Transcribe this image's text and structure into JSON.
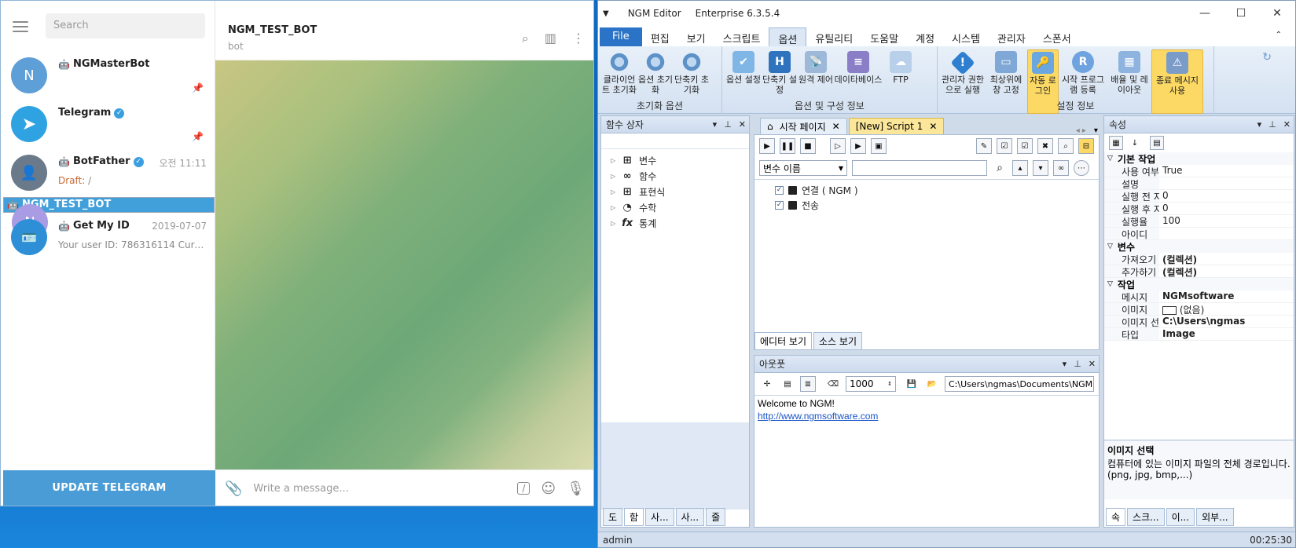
{
  "telegram": {
    "search_placeholder": "Search",
    "chats": [
      {
        "name": "NGMasterBot",
        "avatar_letter": "N",
        "avatar_color": "#5e9fd8",
        "pinned": true,
        "bot": true
      },
      {
        "name": "Telegram",
        "avatar_color": "#2fa3e2",
        "verified": true,
        "pinned": true
      },
      {
        "name": "BotFather",
        "verified": true,
        "bot": true,
        "time": "오전 11:11",
        "draft_label": "Draft:",
        "draft_text": "/"
      },
      {
        "name": "NGM_TEST_BOT",
        "avatar_letter": "N",
        "avatar_color": "#a99be4",
        "bot": true,
        "selected": true
      },
      {
        "name": "Get My ID",
        "bot": true,
        "time": "2019-07-07",
        "message": "Your user ID: 786316114 Curre..."
      }
    ],
    "update_button": "UPDATE TELEGRAM",
    "chat_title": "NGM_TEST_BOT",
    "chat_subtitle": "bot",
    "message_placeholder": "Write a message...",
    "selected_color": "#419fd9"
  },
  "ngm": {
    "app_name": "NGM Editor",
    "edition": "Enterprise 6.3.5.4",
    "menu": [
      "File",
      "편집",
      "보기",
      "스크립트",
      "옵션",
      "유틸리티",
      "도움말",
      "계정",
      "시스템",
      "관리자",
      "스폰서"
    ],
    "active_menu": "옵션",
    "ribbon": {
      "group1": {
        "label": "초기화 옵션",
        "buttons": [
          "클라이언트 초기화",
          "옵션 초기화",
          "단축키 초기화"
        ]
      },
      "group2": {
        "label": "옵션 및 구성 정보",
        "buttons": [
          "옵션 설정",
          "단축키 설정",
          "원격 제어",
          "데이타베이스",
          "FTP"
        ]
      },
      "group3": {
        "label": "설정 정보",
        "buttons": [
          "관리자 권한으로 실행",
          "최상위에 창 고정",
          "자동 로그인",
          "시작 프로그램 등록",
          "배율 및 레이아웃",
          "종료 메시지 사용"
        ]
      }
    },
    "function_panel": {
      "title": "함수 상자",
      "items": [
        "변수",
        "함수",
        "표현식",
        "수학",
        "통계"
      ]
    },
    "doc_tabs": [
      "시작 페이지",
      "[New] Script 1"
    ],
    "script": {
      "var_select": "변수 이름",
      "items": [
        "연결 ( NGM )",
        "전송"
      ],
      "view_tabs": [
        "에디터 보기",
        "소스 보기"
      ]
    },
    "output": {
      "title": "아웃풋",
      "count": "1000",
      "path": "C:\\Users\\ngmas\\Documents\\NGM6\\",
      "line1": "Welcome to NGM!",
      "line2": "http://www.ngmsoftware.com"
    },
    "properties": {
      "title": "속성",
      "cat1": "기본 작업",
      "basic": [
        {
          "k": "사용 여부",
          "v": "True"
        },
        {
          "k": "설명",
          "v": ""
        },
        {
          "k": "실행 전 지연",
          "v": "0"
        },
        {
          "k": "실행 후 지연",
          "v": "0"
        },
        {
          "k": "실행율",
          "v": "100"
        },
        {
          "k": "아이디",
          "v": ""
        }
      ],
      "cat2": "변수",
      "vars": [
        {
          "k": "가져오기",
          "v": "(컬렉션)"
        },
        {
          "k": "추가하기",
          "v": "(컬렉션)"
        }
      ],
      "cat3": "작업",
      "task": [
        {
          "k": "메시지",
          "v": "NGMsoftware"
        },
        {
          "k": "이미지",
          "v": "(없음)"
        },
        {
          "k": "이미지 선택",
          "v": "C:\\Users\\ngmas"
        },
        {
          "k": "타입",
          "v": "Image"
        }
      ],
      "desc_title": "이미지 선택",
      "desc_text": "컴퓨터에 있는 이미지 파일의 전체 경로입니다. (png, jpg, bmp,...)"
    },
    "left_bottom_tabs": [
      "도",
      "함",
      "사...",
      "사...",
      "줄"
    ],
    "right_bottom_tabs": [
      "속",
      "스크...",
      "이...",
      "외부..."
    ],
    "status_user": "admin",
    "status_time": "00:25:30",
    "file_color": "#2b73c6",
    "highlight_color": "#fcd965"
  }
}
